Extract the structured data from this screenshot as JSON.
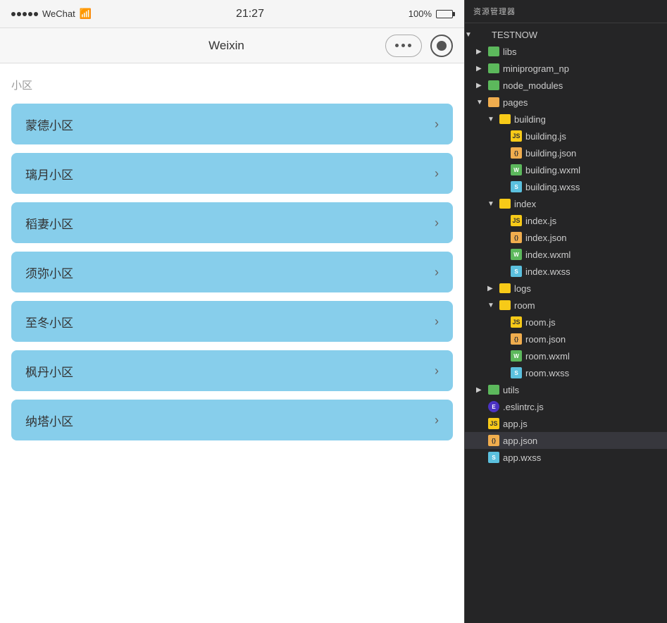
{
  "statusBar": {
    "dots": 5,
    "carrier": "WeChat",
    "wifi": "📶",
    "time": "21:27",
    "battery_percent": "100%"
  },
  "navBar": {
    "title": "Weixin",
    "dots_label": "•••",
    "record_label": "⊙"
  },
  "mainContent": {
    "section_label": "小区",
    "items": [
      {
        "text": "蒙德小区"
      },
      {
        "text": "璃月小区"
      },
      {
        "text": "稻妻小区"
      },
      {
        "text": "须弥小区"
      },
      {
        "text": "至冬小区"
      },
      {
        "text": "枫丹小区"
      },
      {
        "text": "纳塔小区"
      }
    ]
  },
  "filePanel": {
    "header": "资源管理器",
    "tree": [
      {
        "id": "testnow",
        "label": "TESTNOW",
        "type": "root",
        "indent": 0,
        "arrow": "▼",
        "iconType": "none"
      },
      {
        "id": "libs",
        "label": "libs",
        "type": "folder-green",
        "indent": 1,
        "arrow": "▶",
        "iconType": "folder-green"
      },
      {
        "id": "miniprogram_np",
        "label": "miniprogram_np",
        "type": "folder-green",
        "indent": 1,
        "arrow": "▶",
        "iconType": "folder-green"
      },
      {
        "id": "node_modules",
        "label": "node_modules",
        "type": "folder-green",
        "indent": 1,
        "arrow": "▶",
        "iconType": "folder-green"
      },
      {
        "id": "pages",
        "label": "pages",
        "type": "folder-orange",
        "indent": 1,
        "arrow": "▼",
        "iconType": "folder-orange"
      },
      {
        "id": "building",
        "label": "building",
        "type": "folder-yellow",
        "indent": 2,
        "arrow": "▼",
        "iconType": "folder-yellow"
      },
      {
        "id": "building-js",
        "label": "building.js",
        "type": "js",
        "indent": 3,
        "arrow": "",
        "iconType": "js"
      },
      {
        "id": "building-json",
        "label": "building.json",
        "type": "json",
        "indent": 3,
        "arrow": "",
        "iconType": "json"
      },
      {
        "id": "building-wxml",
        "label": "building.wxml",
        "type": "wxml",
        "indent": 3,
        "arrow": "",
        "iconType": "wxml"
      },
      {
        "id": "building-wxss",
        "label": "building.wxss",
        "type": "wxss",
        "indent": 3,
        "arrow": "",
        "iconType": "wxss"
      },
      {
        "id": "index",
        "label": "index",
        "type": "folder-yellow",
        "indent": 2,
        "arrow": "▼",
        "iconType": "folder-yellow"
      },
      {
        "id": "index-js",
        "label": "index.js",
        "type": "js",
        "indent": 3,
        "arrow": "",
        "iconType": "js"
      },
      {
        "id": "index-json",
        "label": "index.json",
        "type": "json",
        "indent": 3,
        "arrow": "",
        "iconType": "json"
      },
      {
        "id": "index-wxml",
        "label": "index.wxml",
        "type": "wxml",
        "indent": 3,
        "arrow": "",
        "iconType": "wxml"
      },
      {
        "id": "index-wxss",
        "label": "index.wxss",
        "type": "wxss",
        "indent": 3,
        "arrow": "",
        "iconType": "wxss"
      },
      {
        "id": "logs",
        "label": "logs",
        "type": "folder-yellow",
        "indent": 2,
        "arrow": "▶",
        "iconType": "folder-yellow"
      },
      {
        "id": "room",
        "label": "room",
        "type": "folder-yellow",
        "indent": 2,
        "arrow": "▼",
        "iconType": "folder-yellow"
      },
      {
        "id": "room-js",
        "label": "room.js",
        "type": "js",
        "indent": 3,
        "arrow": "",
        "iconType": "js"
      },
      {
        "id": "room-json",
        "label": "room.json",
        "type": "json",
        "indent": 3,
        "arrow": "",
        "iconType": "json"
      },
      {
        "id": "room-wxml",
        "label": "room.wxml",
        "type": "wxml",
        "indent": 3,
        "arrow": "",
        "iconType": "wxml"
      },
      {
        "id": "room-wxss",
        "label": "room.wxss",
        "type": "wxss",
        "indent": 3,
        "arrow": "",
        "iconType": "wxss"
      },
      {
        "id": "utils",
        "label": "utils",
        "type": "folder-green",
        "indent": 1,
        "arrow": "▶",
        "iconType": "folder-green"
      },
      {
        "id": "eslintrc",
        "label": ".eslintrc.js",
        "type": "eslint",
        "indent": 1,
        "arrow": "",
        "iconType": "eslint"
      },
      {
        "id": "app-js",
        "label": "app.js",
        "type": "js",
        "indent": 1,
        "arrow": "",
        "iconType": "js"
      },
      {
        "id": "app-json",
        "label": "app.json",
        "type": "json",
        "indent": 1,
        "arrow": "",
        "iconType": "json",
        "active": true
      },
      {
        "id": "app-wxss",
        "label": "app.wxss",
        "type": "wxss",
        "indent": 1,
        "arrow": "",
        "iconType": "wxss"
      }
    ]
  }
}
